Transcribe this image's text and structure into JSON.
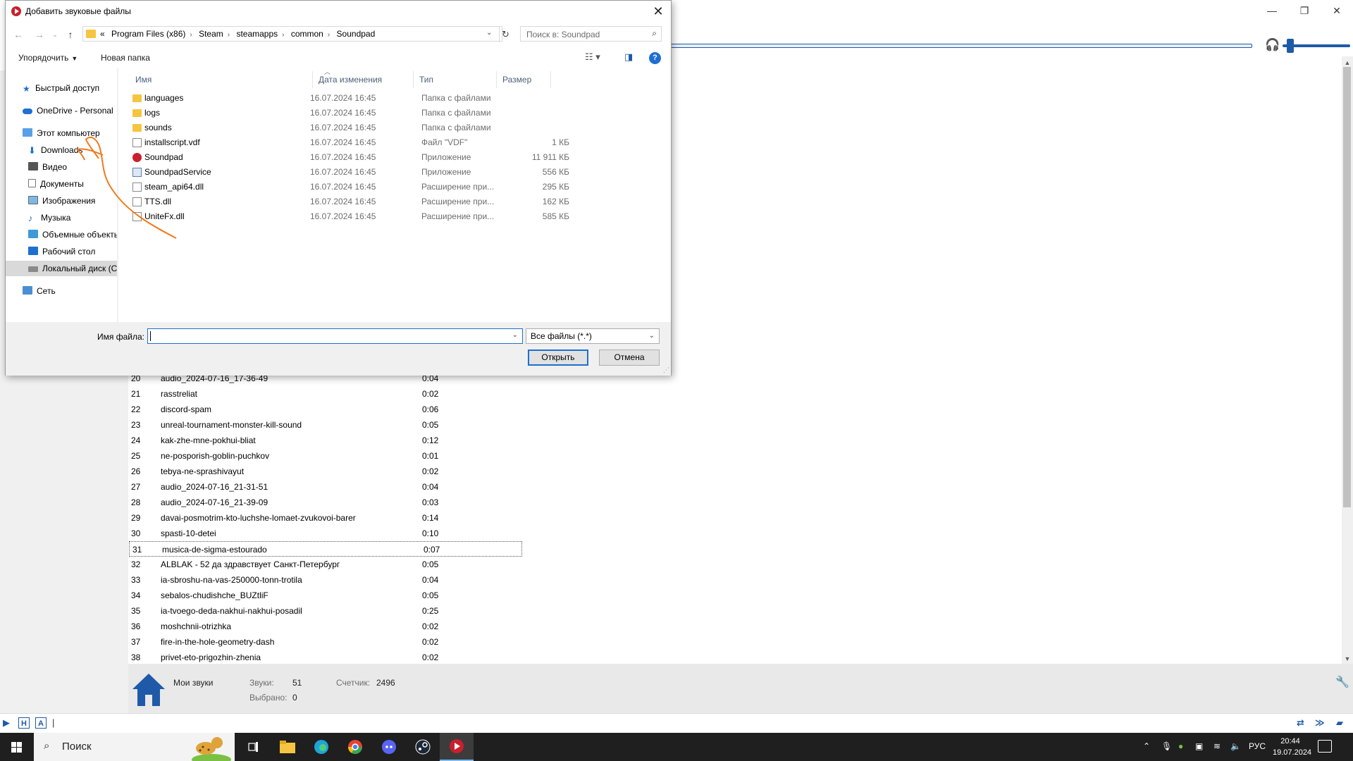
{
  "dialog": {
    "title": "Добавить звуковые файлы",
    "path": [
      "Program Files (x86)",
      "Steam",
      "steamapps",
      "common",
      "Soundpad"
    ],
    "path_prefix": "«",
    "search_placeholder": "Поиск в: Soundpad",
    "organize_label": "Упорядочить",
    "new_folder_label": "Новая папка",
    "nav": {
      "quick_access": "Быстрый доступ",
      "onedrive": "OneDrive - Personal",
      "this_pc": "Этот компьютер",
      "downloads": "Downloads",
      "video": "Видео",
      "documents": "Документы",
      "images": "Изображения",
      "music": "Музыка",
      "objects3d": "Объемные объекты",
      "desktop": "Рабочий стол",
      "local_disk": "Локальный диск (C:)",
      "network": "Сеть"
    },
    "columns": {
      "name": "Имя",
      "date": "Дата изменения",
      "type": "Тип",
      "size": "Размер"
    },
    "files": [
      {
        "name": "languages",
        "date": "16.07.2024 16:45",
        "type": "Папка с файлами",
        "size": "",
        "icon": "folder"
      },
      {
        "name": "logs",
        "date": "16.07.2024 16:45",
        "type": "Папка с файлами",
        "size": "",
        "icon": "folder"
      },
      {
        "name": "sounds",
        "date": "16.07.2024 16:45",
        "type": "Папка с файлами",
        "size": "",
        "icon": "folder"
      },
      {
        "name": "installscript.vdf",
        "date": "16.07.2024 16:45",
        "type": "Файл \"VDF\"",
        "size": "1 КБ",
        "icon": "file"
      },
      {
        "name": "Soundpad",
        "date": "16.07.2024 16:45",
        "type": "Приложение",
        "size": "11 911 КБ",
        "icon": "soundpad"
      },
      {
        "name": "SoundpadService",
        "date": "16.07.2024 16:45",
        "type": "Приложение",
        "size": "556 КБ",
        "icon": "app"
      },
      {
        "name": "steam_api64.dll",
        "date": "16.07.2024 16:45",
        "type": "Расширение при...",
        "size": "295 КБ",
        "icon": "file"
      },
      {
        "name": "TTS.dll",
        "date": "16.07.2024 16:45",
        "type": "Расширение при...",
        "size": "162 КБ",
        "icon": "file"
      },
      {
        "name": "UniteFx.dll",
        "date": "16.07.2024 16:45",
        "type": "Расширение при...",
        "size": "585 КБ",
        "icon": "file"
      }
    ],
    "filename_label": "Имя файла:",
    "filename_value": "",
    "filter_value": "Все файлы (*.*)",
    "open_label": "Открыть",
    "cancel_label": "Отмена"
  },
  "soundpad": {
    "partial_row": {
      "num": "20",
      "name": "audio_2024-07-16_17-36-49",
      "dur": "0:04"
    },
    "rows": [
      {
        "num": "21",
        "name": "rasstreliat",
        "dur": "0:02"
      },
      {
        "num": "22",
        "name": "discord-spam",
        "dur": "0:06"
      },
      {
        "num": "23",
        "name": "unreal-tournament-monster-kill-sound",
        "dur": "0:05"
      },
      {
        "num": "24",
        "name": "kak-zhe-mne-pokhui-bliat",
        "dur": "0:12"
      },
      {
        "num": "25",
        "name": "ne-posporish-goblin-puchkov",
        "dur": "0:01"
      },
      {
        "num": "26",
        "name": "tebya-ne-sprashivayut",
        "dur": "0:02"
      },
      {
        "num": "27",
        "name": "audio_2024-07-16_21-31-51",
        "dur": "0:04"
      },
      {
        "num": "28",
        "name": "audio_2024-07-16_21-39-09",
        "dur": "0:03"
      },
      {
        "num": "29",
        "name": "davai-posmotrim-kto-luchshe-lomaet-zvukovoi-barer",
        "dur": "0:14"
      },
      {
        "num": "30",
        "name": "spasti-10-detei",
        "dur": "0:10"
      },
      {
        "num": "31",
        "name": "musica-de-sigma-estourado",
        "dur": "0:07"
      },
      {
        "num": "32",
        "name": "ALBLAK - 52 да здравствует Санкт-Петербург",
        "dur": "0:05"
      },
      {
        "num": "33",
        "name": "ia-sbroshu-na-vas-250000-tonn-trotila",
        "dur": "0:04"
      },
      {
        "num": "34",
        "name": "sebalos-chudishche_BUZtliF",
        "dur": "0:05"
      },
      {
        "num": "35",
        "name": "ia-tvoego-deda-nakhui-nakhui-posadil",
        "dur": "0:25"
      },
      {
        "num": "36",
        "name": "moshchnii-otrizhka",
        "dur": "0:02"
      },
      {
        "num": "37",
        "name": "fire-in-the-hole-geometry-dash",
        "dur": "0:02"
      },
      {
        "num": "38",
        "name": "privet-eto-prigozhin-zhenia",
        "dur": "0:02"
      }
    ],
    "status": {
      "category": "Мои звуки",
      "sounds_label": "Звуки:",
      "sounds_value": "51",
      "selected_label": "Выбрано:",
      "selected_value": "0",
      "counter_label": "Счетчик:",
      "counter_value": "2496"
    },
    "bottom_icons": {
      "h": "H",
      "a": "A"
    }
  },
  "taskbar": {
    "search_text": "Поиск",
    "lang": "РУС",
    "time": "20:44",
    "date": "19.07.2024"
  }
}
